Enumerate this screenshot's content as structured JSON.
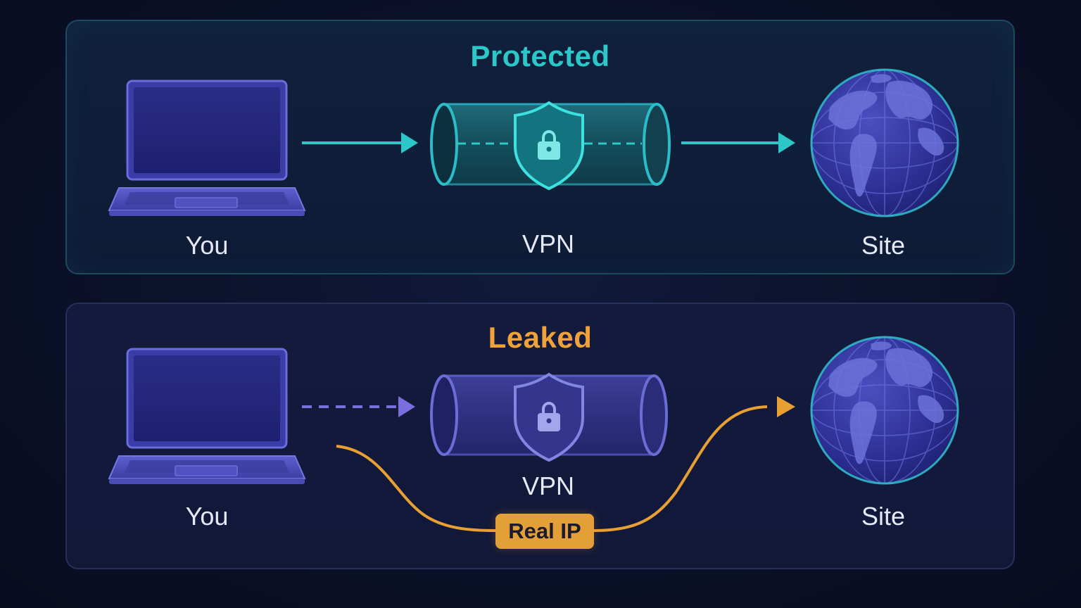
{
  "protected": {
    "title": "Protected",
    "you_label": "You",
    "vpn_label": "VPN",
    "site_label": "Site"
  },
  "leaked": {
    "title": "Leaked",
    "you_label": "You",
    "vpn_label": "VPN",
    "site_label": "Site",
    "leak_badge": "Real IP"
  },
  "colors": {
    "protected_accent": "#2cc7c9",
    "leaked_accent": "#f0a23a",
    "device_purple": "#5b5cc8",
    "background": "#0b1129"
  },
  "icons": [
    "laptop-icon",
    "vpn-tunnel-icon",
    "shield-lock-icon",
    "globe-icon",
    "arrow-icon"
  ]
}
